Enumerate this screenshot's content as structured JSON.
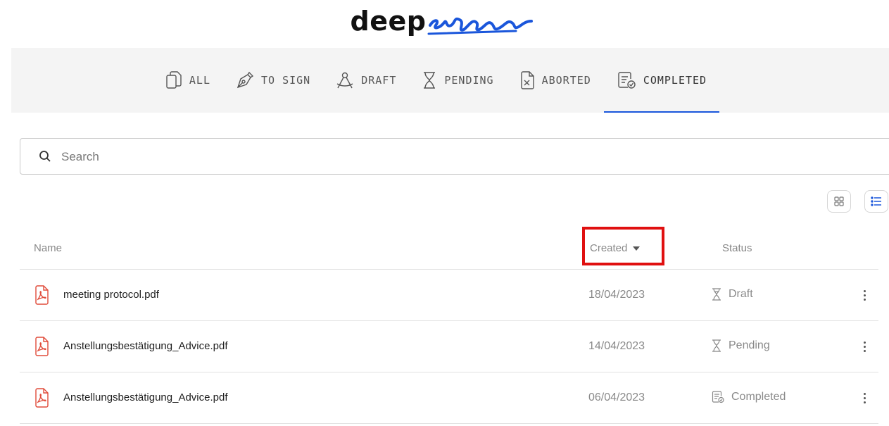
{
  "brand": {
    "logo_text": "deep",
    "logo_script": "sign"
  },
  "tabs": [
    {
      "label": "ALL",
      "icon": "documents-icon",
      "active": false
    },
    {
      "label": "TO SIGN",
      "icon": "pen-nib-icon",
      "active": false
    },
    {
      "label": "DRAFT",
      "icon": "compass-icon",
      "active": false
    },
    {
      "label": "PENDING",
      "icon": "hourglass-icon",
      "active": false
    },
    {
      "label": "ABORTED",
      "icon": "document-x-icon",
      "active": false
    },
    {
      "label": "COMPLETED",
      "icon": "document-check-icon",
      "active": true
    }
  ],
  "search": {
    "placeholder": "Search",
    "value": ""
  },
  "view_toggle": {
    "grid_icon": "grid-view-icon",
    "list_icon": "list-view-icon",
    "selected": "list"
  },
  "table": {
    "columns": {
      "name": "Name",
      "created": "Created",
      "status": "Status"
    },
    "sort": {
      "column": "created",
      "direction": "desc",
      "icon": "caret-down-icon"
    },
    "rows": [
      {
        "name": "meeting protocol.pdf",
        "created": "18/04/2023",
        "status": "Draft",
        "status_icon": "hourglass-icon"
      },
      {
        "name": "Anstellungsbestätigung_Advice.pdf",
        "created": "14/04/2023",
        "status": "Pending",
        "status_icon": "hourglass-icon"
      },
      {
        "name": "Anstellungsbestätigung_Advice.pdf",
        "created": "06/04/2023",
        "status": "Completed",
        "status_icon": "document-check-icon"
      }
    ]
  },
  "colors": {
    "accent": "#1a56db",
    "highlight": "#e01010",
    "pdf_icon": "#e04b3a",
    "nav_bg": "#f4f4f4"
  }
}
